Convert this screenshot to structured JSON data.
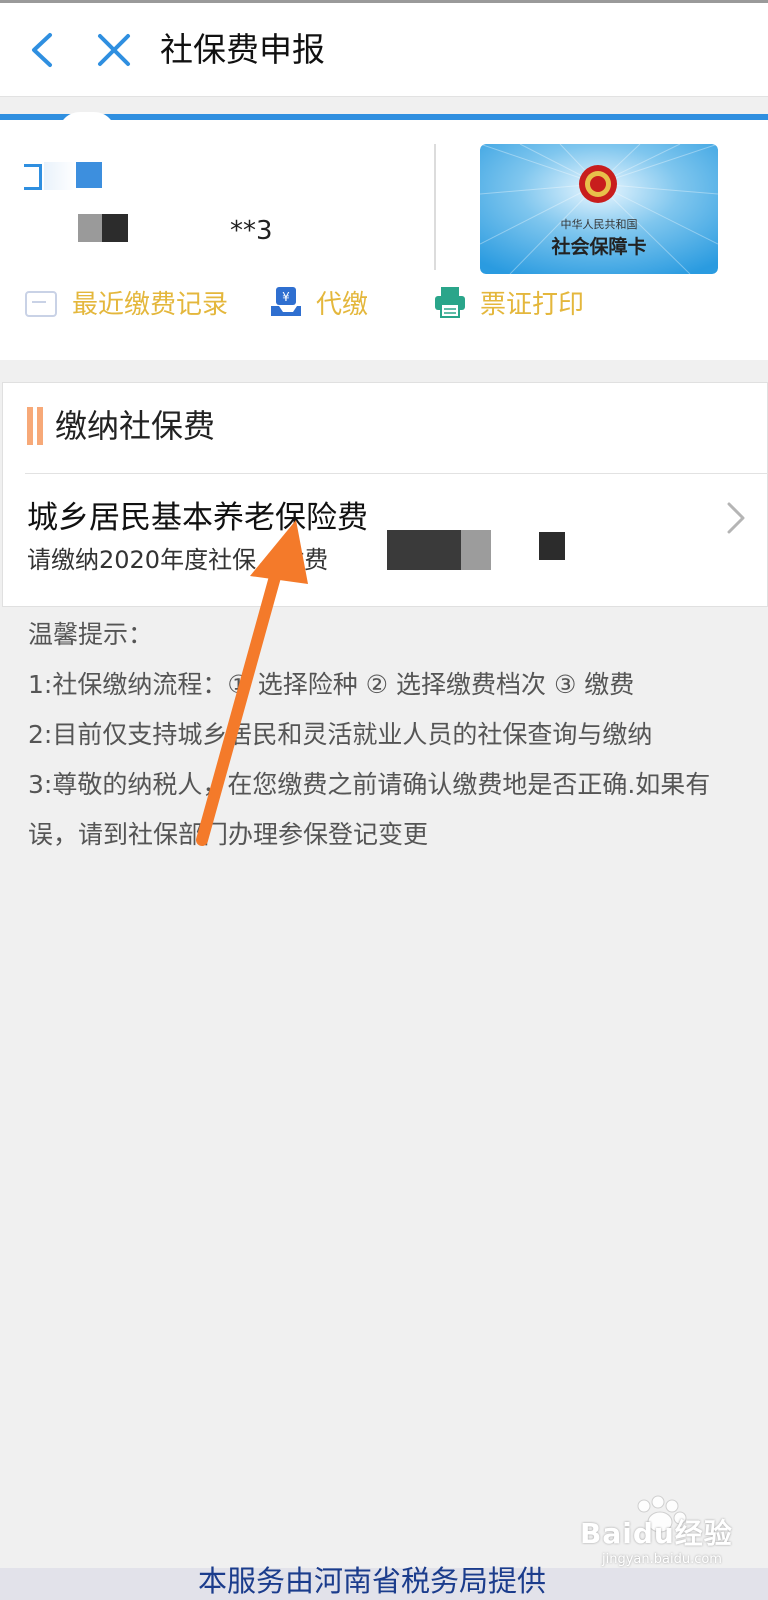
{
  "header": {
    "title": "社保费申报",
    "back_icon": "back-chevron-icon",
    "close_icon": "close-icon"
  },
  "user": {
    "id_tail": "**3",
    "card": {
      "line1": "中华人民共和国",
      "line2": "社会保障卡"
    }
  },
  "quick_links": [
    {
      "label": "最近缴费记录",
      "icon": "record-icon"
    },
    {
      "label": "代缴",
      "icon": "payment-icon"
    },
    {
      "label": "票证打印",
      "icon": "printer-icon"
    }
  ],
  "pay_section": {
    "title": "缴纳社保费",
    "item": {
      "title": "城乡居民基本养老保险费",
      "subtitle": "请缴纳2020年度社保，缴费"
    }
  },
  "tips": {
    "title": "温馨提示：",
    "line1": "1:社保缴纳流程：① 选择险种 ② 选择缴费档次 ③ 缴费",
    "line2": "2:目前仅支持城乡居民和灵活就业人员的社保查询与缴纳",
    "line3": "3:尊敬的纳税人，在您缴费之前请确认缴费地是否正确.如果有误，请到社保部门办理参保登记变更"
  },
  "footer": {
    "text": "本服务由河南省税务局提供"
  },
  "watermark": {
    "brand": "Baidu经验",
    "url": "jingyan.baidu.com"
  },
  "colors": {
    "accent_blue": "#2f8fe0",
    "link_gold": "#e4b73c",
    "section_bar": "#f7a978",
    "annotation_arrow": "#f47a2a",
    "footer_text": "#1b3c8c"
  }
}
